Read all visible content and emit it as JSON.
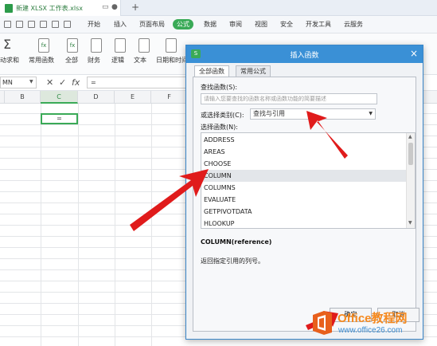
{
  "titlebar": {
    "doc_title": "新建 XLSX 工作表.xlsx",
    "new_tab": "+"
  },
  "menu": {
    "items": [
      "开始",
      "插入",
      "页面布局",
      "公式",
      "数据",
      "审阅",
      "视图",
      "安全",
      "开发工具",
      "云服务"
    ],
    "active": "公式"
  },
  "ribbon": {
    "labels": [
      "动求和",
      "常用函数",
      "全部",
      "财务",
      "逻辑",
      "文本",
      "日期和时间"
    ],
    "sigma": "Σ",
    "fx": "fx"
  },
  "formula_bar": {
    "name_box": "MN",
    "fx": "fx",
    "content": "="
  },
  "grid": {
    "columns": [
      "B",
      "C",
      "D",
      "E",
      "F"
    ],
    "selected_column": "C",
    "active_cell_value": "="
  },
  "dialog": {
    "title": "插入函数",
    "logo": "S",
    "close": "×",
    "tabs": [
      "全部函数",
      "常用公式"
    ],
    "search_label": "查找函数(S):",
    "search_placeholder": "请输入您要查找的函数名称或函数功能的简要描述",
    "category_label": "或选择类别(C):",
    "category_value": "查找与引用",
    "list_label": "选择函数(N):",
    "functions": [
      "ADDRESS",
      "AREAS",
      "CHOOSE",
      "COLUMN",
      "COLUMNS",
      "EVALUATE",
      "GETPIVOTDATA",
      "HLOOKUP"
    ],
    "selected_function": "COLUMN",
    "signature": "COLUMN(reference)",
    "description": "返回指定引用的列号。",
    "ok": "确定",
    "cancel": "取消"
  },
  "watermark": {
    "brand": "Office教程网",
    "url": "www.office26.com"
  },
  "colors": {
    "accent_green": "#3aaa57",
    "dialog_blue": "#3a90d6",
    "arrow_red": "#e01b1b",
    "watermark_orange": "#f5891f"
  }
}
